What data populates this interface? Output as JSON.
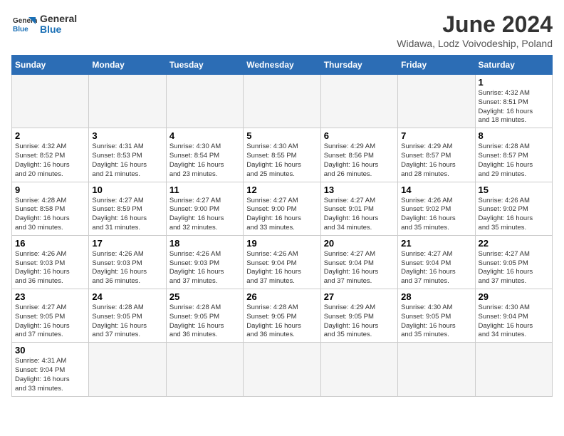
{
  "logo": {
    "text_general": "General",
    "text_blue": "Blue"
  },
  "header": {
    "month_year": "June 2024",
    "location": "Widawa, Lodz Voivodeship, Poland"
  },
  "weekdays": [
    "Sunday",
    "Monday",
    "Tuesday",
    "Wednesday",
    "Thursday",
    "Friday",
    "Saturday"
  ],
  "weeks": [
    [
      {
        "day": "",
        "info": ""
      },
      {
        "day": "",
        "info": ""
      },
      {
        "day": "",
        "info": ""
      },
      {
        "day": "",
        "info": ""
      },
      {
        "day": "",
        "info": ""
      },
      {
        "day": "",
        "info": ""
      },
      {
        "day": "1",
        "info": "Sunrise: 4:32 AM\nSunset: 8:51 PM\nDaylight: 16 hours\nand 18 minutes."
      }
    ],
    [
      {
        "day": "2",
        "info": "Sunrise: 4:32 AM\nSunset: 8:52 PM\nDaylight: 16 hours\nand 20 minutes."
      },
      {
        "day": "3",
        "info": "Sunrise: 4:31 AM\nSunset: 8:53 PM\nDaylight: 16 hours\nand 21 minutes."
      },
      {
        "day": "4",
        "info": "Sunrise: 4:30 AM\nSunset: 8:54 PM\nDaylight: 16 hours\nand 23 minutes."
      },
      {
        "day": "5",
        "info": "Sunrise: 4:30 AM\nSunset: 8:55 PM\nDaylight: 16 hours\nand 25 minutes."
      },
      {
        "day": "6",
        "info": "Sunrise: 4:29 AM\nSunset: 8:56 PM\nDaylight: 16 hours\nand 26 minutes."
      },
      {
        "day": "7",
        "info": "Sunrise: 4:29 AM\nSunset: 8:57 PM\nDaylight: 16 hours\nand 28 minutes."
      },
      {
        "day": "8",
        "info": "Sunrise: 4:28 AM\nSunset: 8:57 PM\nDaylight: 16 hours\nand 29 minutes."
      }
    ],
    [
      {
        "day": "9",
        "info": "Sunrise: 4:28 AM\nSunset: 8:58 PM\nDaylight: 16 hours\nand 30 minutes."
      },
      {
        "day": "10",
        "info": "Sunrise: 4:27 AM\nSunset: 8:59 PM\nDaylight: 16 hours\nand 31 minutes."
      },
      {
        "day": "11",
        "info": "Sunrise: 4:27 AM\nSunset: 9:00 PM\nDaylight: 16 hours\nand 32 minutes."
      },
      {
        "day": "12",
        "info": "Sunrise: 4:27 AM\nSunset: 9:00 PM\nDaylight: 16 hours\nand 33 minutes."
      },
      {
        "day": "13",
        "info": "Sunrise: 4:27 AM\nSunset: 9:01 PM\nDaylight: 16 hours\nand 34 minutes."
      },
      {
        "day": "14",
        "info": "Sunrise: 4:26 AM\nSunset: 9:02 PM\nDaylight: 16 hours\nand 35 minutes."
      },
      {
        "day": "15",
        "info": "Sunrise: 4:26 AM\nSunset: 9:02 PM\nDaylight: 16 hours\nand 35 minutes."
      }
    ],
    [
      {
        "day": "16",
        "info": "Sunrise: 4:26 AM\nSunset: 9:03 PM\nDaylight: 16 hours\nand 36 minutes."
      },
      {
        "day": "17",
        "info": "Sunrise: 4:26 AM\nSunset: 9:03 PM\nDaylight: 16 hours\nand 36 minutes."
      },
      {
        "day": "18",
        "info": "Sunrise: 4:26 AM\nSunset: 9:03 PM\nDaylight: 16 hours\nand 37 minutes."
      },
      {
        "day": "19",
        "info": "Sunrise: 4:26 AM\nSunset: 9:04 PM\nDaylight: 16 hours\nand 37 minutes."
      },
      {
        "day": "20",
        "info": "Sunrise: 4:27 AM\nSunset: 9:04 PM\nDaylight: 16 hours\nand 37 minutes."
      },
      {
        "day": "21",
        "info": "Sunrise: 4:27 AM\nSunset: 9:04 PM\nDaylight: 16 hours\nand 37 minutes."
      },
      {
        "day": "22",
        "info": "Sunrise: 4:27 AM\nSunset: 9:05 PM\nDaylight: 16 hours\nand 37 minutes."
      }
    ],
    [
      {
        "day": "23",
        "info": "Sunrise: 4:27 AM\nSunset: 9:05 PM\nDaylight: 16 hours\nand 37 minutes."
      },
      {
        "day": "24",
        "info": "Sunrise: 4:28 AM\nSunset: 9:05 PM\nDaylight: 16 hours\nand 37 minutes."
      },
      {
        "day": "25",
        "info": "Sunrise: 4:28 AM\nSunset: 9:05 PM\nDaylight: 16 hours\nand 36 minutes."
      },
      {
        "day": "26",
        "info": "Sunrise: 4:28 AM\nSunset: 9:05 PM\nDaylight: 16 hours\nand 36 minutes."
      },
      {
        "day": "27",
        "info": "Sunrise: 4:29 AM\nSunset: 9:05 PM\nDaylight: 16 hours\nand 35 minutes."
      },
      {
        "day": "28",
        "info": "Sunrise: 4:30 AM\nSunset: 9:05 PM\nDaylight: 16 hours\nand 35 minutes."
      },
      {
        "day": "29",
        "info": "Sunrise: 4:30 AM\nSunset: 9:04 PM\nDaylight: 16 hours\nand 34 minutes."
      }
    ],
    [
      {
        "day": "30",
        "info": "Sunrise: 4:31 AM\nSunset: 9:04 PM\nDaylight: 16 hours\nand 33 minutes."
      },
      {
        "day": "",
        "info": ""
      },
      {
        "day": "",
        "info": ""
      },
      {
        "day": "",
        "info": ""
      },
      {
        "day": "",
        "info": ""
      },
      {
        "day": "",
        "info": ""
      },
      {
        "day": "",
        "info": ""
      }
    ]
  ]
}
